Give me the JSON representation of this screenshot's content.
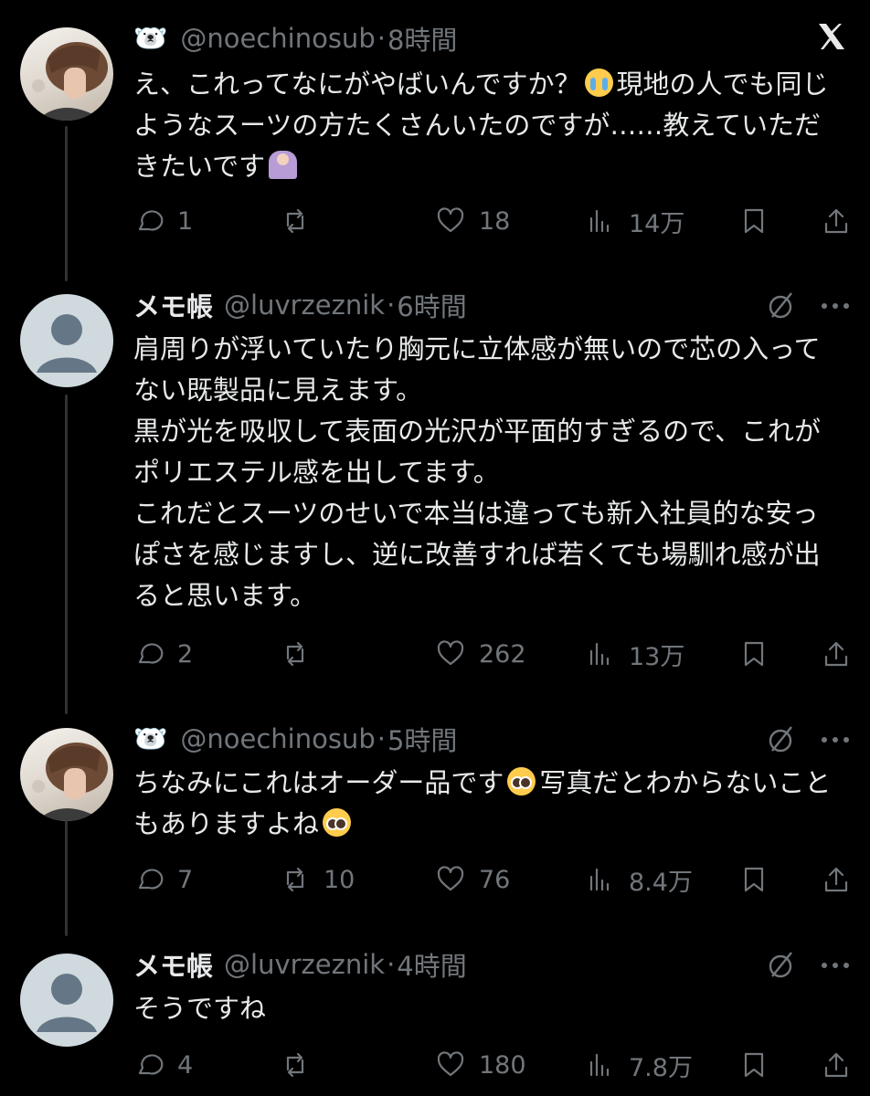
{
  "posts": [
    {
      "display_name": "",
      "name_emoji": "🐻‍❄️",
      "handle": "@noechinosub",
      "time": "8時間",
      "paragraphs": [
        "え、これってなにがやばいんですか？",
        "現地の人でも同じようなスーツの方たくさんいたのですが……教えていただきたいです"
      ],
      "emoji": [
        "loudly-crying-face",
        "person-bowing"
      ],
      "replies": "1",
      "reposts": "",
      "likes": "18",
      "views": "14万"
    },
    {
      "display_name": "メモ帳",
      "handle": "@luvrzeznik",
      "time": "6時間",
      "paragraphs": [
        "肩周りが浮いていたり胸元に立体感が無いので芯の入ってない既製品に見えます。",
        "黒が光を吸収して表面の光沢が平面的すぎるので、これがポリエステル感を出してます。",
        "これだとスーツのせいで本当は違っても新入社員的な安っぽさを感じますし、逆に改善すれば若くても場馴れ感が出ると思います。"
      ],
      "replies": "2",
      "reposts": "",
      "likes": "262",
      "views": "13万"
    },
    {
      "display_name": "",
      "name_emoji": "🐻‍❄️",
      "handle": "@noechinosub",
      "time": "5時間",
      "paragraphs": [
        "ちなみにこれはオーダー品です",
        "写真だとわからないこともありますよね"
      ],
      "emoji": [
        "pleading-face",
        "pleading-face"
      ],
      "replies": "7",
      "reposts": "10",
      "likes": "76",
      "views": "8.4万"
    },
    {
      "display_name": "メモ帳",
      "handle": "@luvrzeznik",
      "time": "4時間",
      "paragraphs": [
        "そうですね"
      ],
      "replies": "4",
      "reposts": "",
      "likes": "180",
      "views": "7.8万"
    }
  ],
  "icons": {
    "header": "x-logo",
    "post_menu": [
      "grok-icon",
      "more-icon"
    ],
    "actions": [
      "reply-icon",
      "repost-icon",
      "like-icon",
      "views-icon",
      "bookmark-icon",
      "share-icon"
    ]
  },
  "colors": {
    "background": "#000000",
    "primary_text": "#e7e9ea",
    "secondary_text": "#71767b",
    "thread_line": "#2f3336",
    "default_avatar": "#cfd9de"
  }
}
